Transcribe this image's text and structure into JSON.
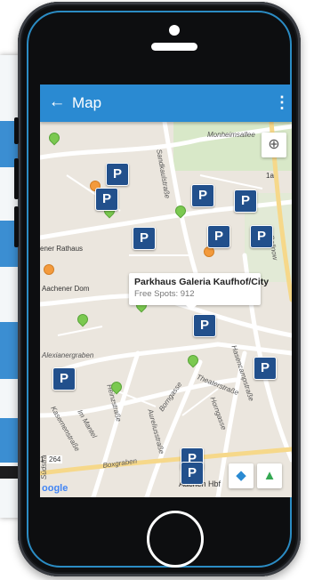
{
  "appbar": {
    "title": "Map",
    "back_icon": "arrow-left-icon",
    "menu_icon": "more-vert-icon"
  },
  "map": {
    "labels": {
      "monheimsallee": "Monheimsallee",
      "sandkaulstrasse": "Sandkaulstraße",
      "rathaus": "ener Rathaus",
      "dom": "Aachener Dom",
      "alexianergraben": "Alexianergraben",
      "theaterstrasse": "Theaterstraße",
      "hansemannstrasse": "Hasencampstraße",
      "borngasse": "Borngasse",
      "kasernenstrasse": "Kasernenstraße",
      "mantel": "Im Mantel",
      "aureliusstrasse": "Aureliusstraße",
      "heinzstrasse": "Heinzstraße",
      "hornstrasse": "Horngasse",
      "boxgraben": "Boxgraben",
      "road264": "264",
      "road1a": "1a",
      "road1": "1",
      "hbf": "Aachen Hbf",
      "gollnow": "Gollnow",
      "sudstrasse": "Südstra"
    },
    "parking_letter": "P",
    "popup": {
      "title": "Parkhaus Galeria Kaufhof/City",
      "subtitle": "Free Spots: 912"
    },
    "google": "oogle",
    "locate_icon": "my-location-icon",
    "directions_icon": "directions-icon",
    "maps_icon": "google-maps-icon"
  },
  "colors": {
    "appbar": "#2a8ad2",
    "parking": "#22508c",
    "pin_green": "#7bc950",
    "pin_orange": "#f39a3c"
  }
}
